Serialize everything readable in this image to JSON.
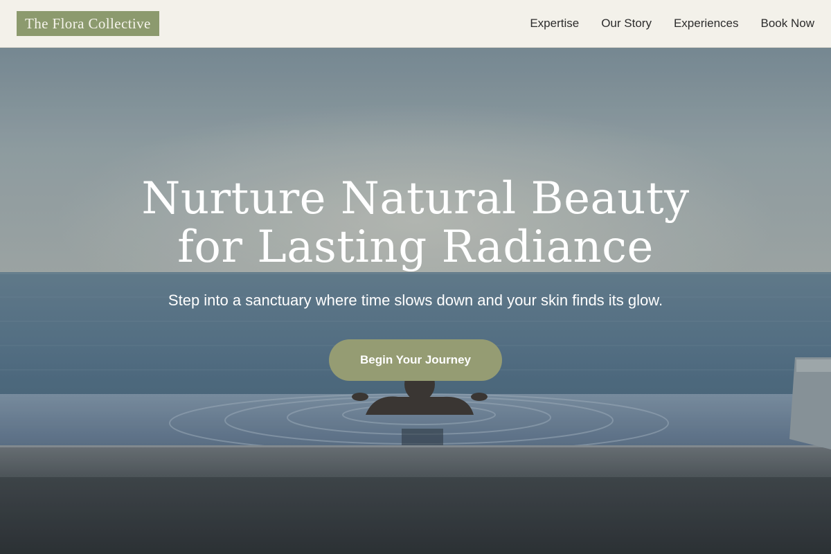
{
  "brand": {
    "name": "The Flora Collective"
  },
  "nav": {
    "items": [
      {
        "label": "Expertise"
      },
      {
        "label": "Our Story"
      },
      {
        "label": "Experiences"
      },
      {
        "label": "Book Now"
      }
    ]
  },
  "hero": {
    "title_line1": "Nurture Natural Beauty",
    "title_line2": "for Lasting Radiance",
    "subtitle": "Step into a sanctuary where time slows down and your skin finds its glow.",
    "cta_label": "Begin Your Journey"
  },
  "colors": {
    "header_bg": "#f3f1ea",
    "logo_bg": "#8c9a6e",
    "cta_bg": "#959c73",
    "text_light": "#ffffff",
    "nav_text": "#2c2c2c"
  },
  "background_image": {
    "subject": "person-swimming-in-infinity-pool-overlooking-sea"
  }
}
